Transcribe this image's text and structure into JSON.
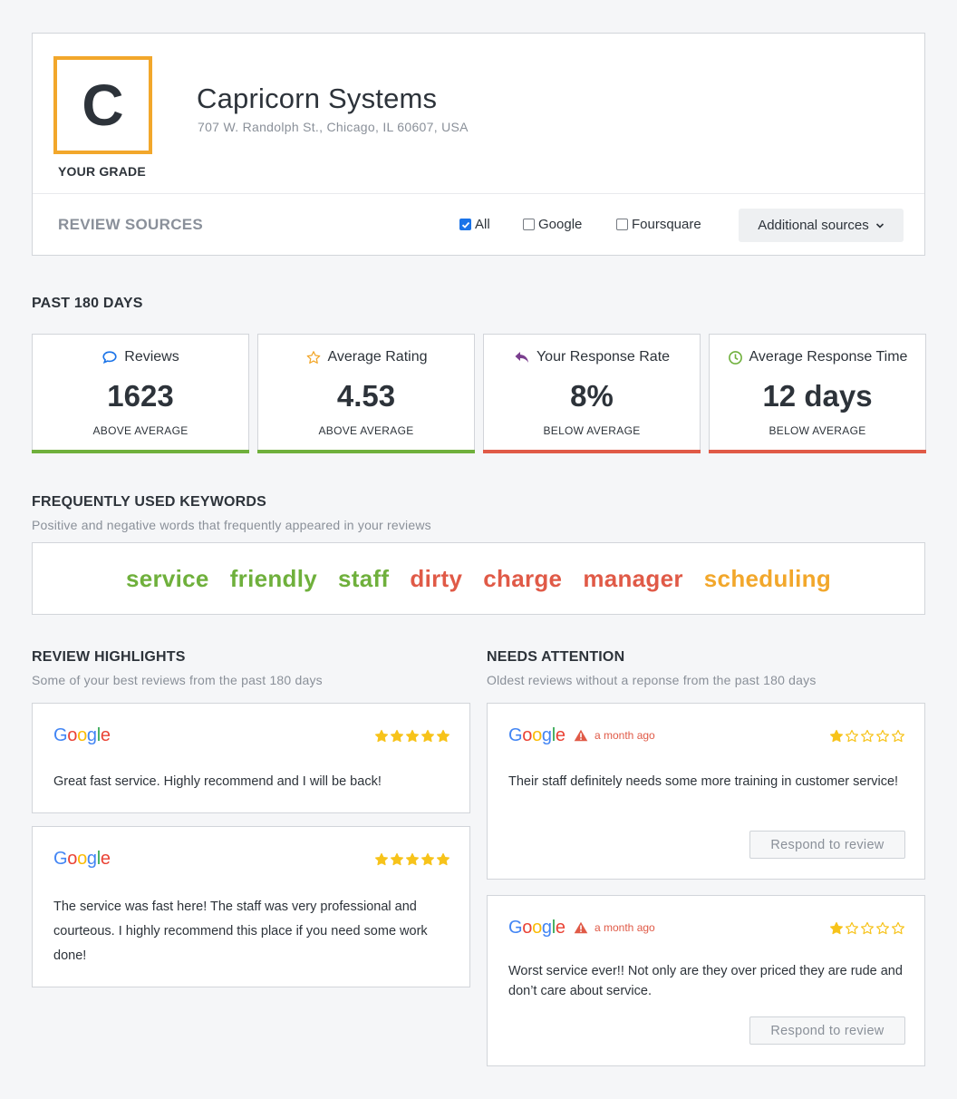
{
  "header": {
    "grade": "C",
    "grade_label": "YOUR GRADE",
    "business_name": "Capricorn Systems",
    "address": "707 W. Randolph St., Chicago, IL 60607, USA"
  },
  "sources": {
    "label": "REVIEW SOURCES",
    "options": [
      {
        "label": "All",
        "checked": true
      },
      {
        "label": "Google",
        "checked": false
      },
      {
        "label": "Foursquare",
        "checked": false
      }
    ],
    "additional": "Additional sources"
  },
  "period": {
    "title": "PAST 180 DAYS",
    "stats": [
      {
        "label": "Reviews",
        "value": "1623",
        "note": "ABOVE AVERAGE",
        "icon": "chat-bubble-icon",
        "status": "good"
      },
      {
        "label": "Average Rating",
        "value": "4.53",
        "note": "ABOVE AVERAGE",
        "icon": "star-outline-icon",
        "status": "good"
      },
      {
        "label": "Your Response Rate",
        "value": "8%",
        "note": "BELOW AVERAGE",
        "icon": "reply-arrow-icon",
        "status": "bad"
      },
      {
        "label": "Average Response Time",
        "value": "12 days",
        "note": "BELOW AVERAGE",
        "icon": "clock-icon",
        "status": "bad"
      }
    ]
  },
  "keywords": {
    "title": "FREQUENTLY USED KEYWORDS",
    "subtitle": "Positive and negative words that frequently appeared in your reviews",
    "words": [
      {
        "word": "service",
        "sentiment": "positive"
      },
      {
        "word": "friendly",
        "sentiment": "positive"
      },
      {
        "word": "staff",
        "sentiment": "positive"
      },
      {
        "word": "dirty",
        "sentiment": "negative"
      },
      {
        "word": "charge",
        "sentiment": "negative"
      },
      {
        "word": "manager",
        "sentiment": "negative"
      },
      {
        "word": "scheduling",
        "sentiment": "neutral"
      }
    ]
  },
  "highlights": {
    "title": "REVIEW HIGHLIGHTS",
    "subtitle": "Some of your best reviews from the past 180 days",
    "reviews": [
      {
        "source": "Google",
        "rating": 5,
        "text": "Great fast service. Highly recommend and I will be back!"
      },
      {
        "source": "Google",
        "rating": 5,
        "text": "The service was fast here! The staff was very professional and courteous. I highly recommend this place if you need some work done!"
      }
    ]
  },
  "attention": {
    "title": "NEEDS ATTENTION",
    "subtitle": "Oldest reviews without a reponse from the past 180 days",
    "reviews": [
      {
        "source": "Google",
        "rating": 1,
        "age": "a month ago",
        "text": "Their staff definitely needs some more training in customer service!",
        "button": "Respond to review"
      },
      {
        "source": "Google",
        "rating": 1,
        "age": "a month ago",
        "text": "Worst service ever!!  Not only are they over priced they are rude and don’t care about service.",
        "button": "Respond to review"
      }
    ]
  },
  "colors": {
    "grade_accent": "#f2a72b",
    "good": "#6fb03c",
    "bad": "#e05a47",
    "neutral": "#f2a72b",
    "star": "#f7c31a"
  }
}
